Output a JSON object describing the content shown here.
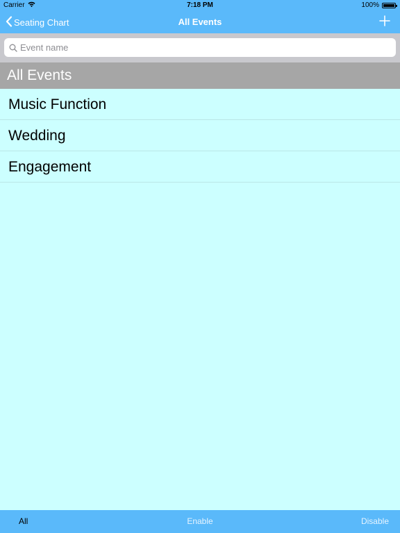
{
  "status_bar": {
    "carrier": "Carrier",
    "time": "7:18 PM",
    "battery": "100%",
    "battery_level": 1.0
  },
  "nav_bar": {
    "back_label": "Seating Chart",
    "title": "All Events",
    "add_icon": "plus-icon"
  },
  "search": {
    "placeholder": "Event name",
    "value": ""
  },
  "section": {
    "title": "All Events"
  },
  "events": [
    {
      "name": "Music Function"
    },
    {
      "name": "Wedding"
    },
    {
      "name": "Engagement"
    }
  ],
  "toolbar": {
    "all_label": "All",
    "enable_label": "Enable",
    "disable_label": "Disable"
  },
  "colors": {
    "bar": "#5ab9fa",
    "list_background": "#ccffff",
    "section_header": "#a6a6a6"
  }
}
